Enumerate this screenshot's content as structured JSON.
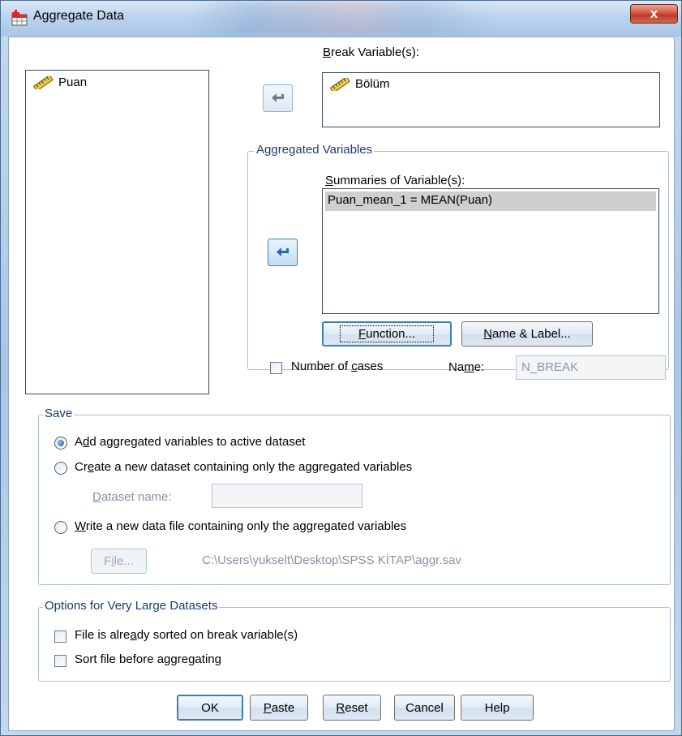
{
  "window": {
    "title": "Aggregate Data",
    "close_label": "x"
  },
  "source_list": {
    "items": [
      {
        "label": "Puan",
        "icon": "scale-ruler-icon"
      }
    ]
  },
  "break_variables": {
    "label": "Break Variable(s):",
    "items": [
      {
        "label": "Bölüm",
        "icon": "scale-ruler-icon"
      }
    ]
  },
  "aggregated": {
    "group_title": "Aggregated Variables",
    "summaries_label": "Summaries of Variable(s):",
    "items": [
      {
        "label": "Puan_mean_1 = MEAN(Puan)",
        "selected": true
      }
    ],
    "function_button": "Function...",
    "name_label_button": "Name & Label...",
    "number_of_cases_label": "Number of cases",
    "number_of_cases_checked": false,
    "name_label": "Name:",
    "name_value": "N_BREAK"
  },
  "save": {
    "group_title": "Save",
    "option_add": "Add aggregated variables to active dataset",
    "option_create": "Create a new dataset containing only the aggregated variables",
    "dataset_name_label": "Dataset name:",
    "dataset_name_value": "",
    "option_write": "Write a new data file containing only the aggregated variables",
    "file_button": "File...",
    "file_path": "C:\\Users\\yukselt\\Desktop\\SPSS KİTAP\\aggr.sav",
    "selected_option": "add"
  },
  "options": {
    "group_title": "Options for Very Large Datasets",
    "sorted_label": "File is already sorted on break variable(s)",
    "sort_label": "Sort file before aggregating"
  },
  "buttons": {
    "ok": "OK",
    "paste": "Paste",
    "reset": "Reset",
    "cancel": "Cancel",
    "help": "Help"
  }
}
